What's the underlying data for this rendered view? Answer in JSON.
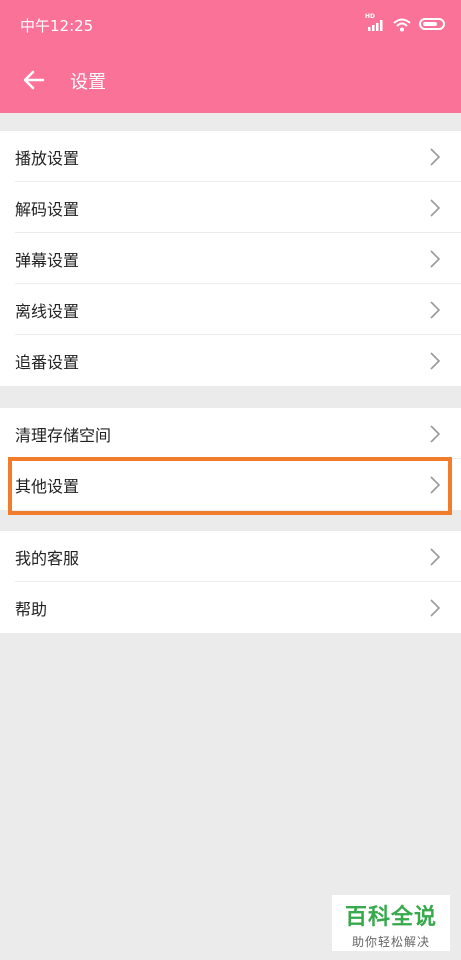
{
  "status_bar": {
    "time": "中午12:25",
    "signal_label": "HD",
    "icons": [
      "signal-icon",
      "wifi-icon",
      "battery-icon"
    ]
  },
  "header": {
    "title": "设置",
    "back_icon": "back-arrow-icon",
    "background_color": "#fb7299"
  },
  "settings": {
    "group1": [
      {
        "label": "播放设置"
      },
      {
        "label": "解码设置"
      },
      {
        "label": "弹幕设置"
      },
      {
        "label": "离线设置"
      },
      {
        "label": "追番设置"
      }
    ],
    "group2": [
      {
        "label": "清理存储空间"
      },
      {
        "label": "其他设置"
      }
    ],
    "group3": [
      {
        "label": "我的客服"
      },
      {
        "label": "帮助"
      }
    ]
  },
  "highlight": {
    "target": "其他设置",
    "color": "#f07c2c"
  },
  "watermark": {
    "main": "百科全说",
    "sub": "助你轻松解决"
  }
}
